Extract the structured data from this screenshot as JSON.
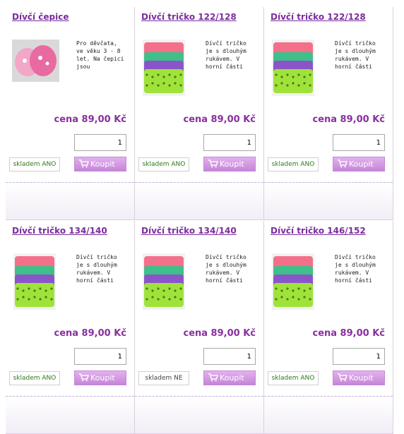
{
  "products": [
    {
      "title": "Dívčí čepice",
      "description": "Pro děvčata, ve věku 3 - 8 let. Na čepici jsou",
      "price": "cena 89,00 Kč",
      "quantity": "1",
      "stock": "skladem ANO",
      "in_stock": true,
      "buy_label": "Koupit",
      "image": "pink-caps-image"
    },
    {
      "title": "Dívčí tričko 122/128",
      "description": "Dívčí tričko je s dlouhým rukávem. V horní části",
      "price": "cena 89,00 Kč",
      "quantity": "1",
      "stock": "skladem ANO",
      "in_stock": true,
      "buy_label": "Koupit",
      "image": "shirts-stack-image"
    },
    {
      "title": "Dívčí tričko 122/128",
      "description": "Dívčí tričko je s dlouhým rukávem. V horní části",
      "price": "cena 89,00 Kč",
      "quantity": "1",
      "stock": "skladem ANO",
      "in_stock": true,
      "buy_label": "Koupit",
      "image": "shirts-stack-image"
    },
    {
      "title": "Dívčí tričko 134/140",
      "description": "Dívčí tričko je s dlouhým rukávem. V horní části",
      "price": "cena 89,00 Kč",
      "quantity": "1",
      "stock": "skladem ANO",
      "in_stock": true,
      "buy_label": "Koupit",
      "image": "shirts-stack-image"
    },
    {
      "title": "Dívčí tričko 134/140",
      "description": "Dívčí tričko je s dlouhým rukávem. V horní části",
      "price": "cena 89,00 Kč",
      "quantity": "1",
      "stock": "skladem NE",
      "in_stock": false,
      "buy_label": "Koupit",
      "image": "shirts-stack-image"
    },
    {
      "title": "Dívčí tričko 146/152",
      "description": "Dívčí tričko je s dlouhým rukávem. V horní části",
      "price": "cena 89,00 Kč",
      "quantity": "1",
      "stock": "skladem ANO",
      "in_stock": true,
      "buy_label": "Koupit",
      "image": "shirts-stack-image"
    }
  ],
  "colors": {
    "title": "#7b2c9e",
    "price": "#8a2f9f",
    "buy_button": "#c685d8",
    "in_stock": "#2d7a16",
    "shirt_pink": "#f4708a",
    "shirt_green": "#3fbf8a",
    "shirt_purple": "#8b55c9",
    "shirt_lime": "#9fe33a",
    "cap_pink": "#e86aa0"
  }
}
